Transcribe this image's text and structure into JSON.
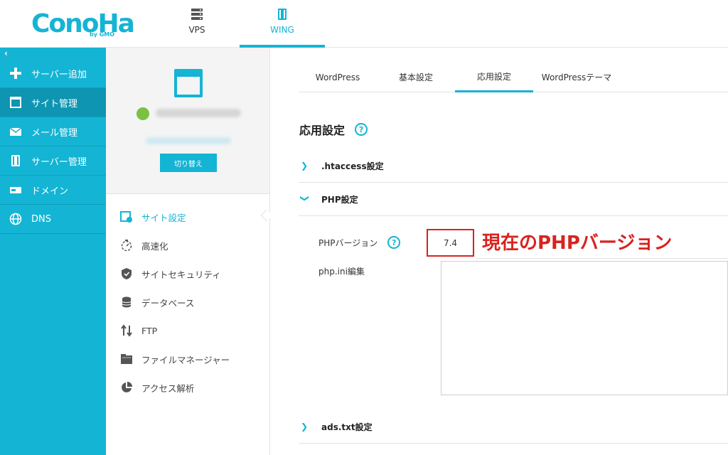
{
  "brand": {
    "logo": "ConoHa",
    "logo_sub": "by GMO"
  },
  "topnav": [
    {
      "label": "VPS",
      "icon": "server-icon"
    },
    {
      "label": "WING",
      "icon": "server-stack-icon",
      "active": true
    }
  ],
  "sidebar": {
    "collapse": "‹",
    "items": [
      {
        "label": "サーバー追加",
        "icon": "plus-icon"
      },
      {
        "label": "サイト管理",
        "icon": "window-icon",
        "active": true
      },
      {
        "label": "メール管理",
        "icon": "mail-icon"
      },
      {
        "label": "サーバー管理",
        "icon": "server-icon"
      },
      {
        "label": "ドメイン",
        "icon": "domain-icon"
      },
      {
        "label": "DNS",
        "icon": "globe-icon"
      }
    ]
  },
  "site_panel": {
    "switch_label": "切り替え",
    "menu": [
      {
        "label": "サイト設定",
        "icon": "site-settings-icon",
        "active": true
      },
      {
        "label": "高速化",
        "icon": "stopwatch-icon"
      },
      {
        "label": "サイトセキュリティ",
        "icon": "shield-icon"
      },
      {
        "label": "データベース",
        "icon": "database-icon"
      },
      {
        "label": "FTP",
        "icon": "transfer-arrows-icon"
      },
      {
        "label": "ファイルマネージャー",
        "icon": "folder-icon"
      },
      {
        "label": "アクセス解析",
        "icon": "pie-chart-icon"
      }
    ]
  },
  "main": {
    "tabs": [
      {
        "label": "WordPress"
      },
      {
        "label": "基本設定"
      },
      {
        "label": "応用設定",
        "active": true
      },
      {
        "label": "WordPressテーマ"
      }
    ],
    "section_title": "応用設定",
    "help_glyph": "?",
    "htaccess_label": ".htaccess設定",
    "php_label": "PHP設定",
    "php_version_label": "PHPバージョン",
    "php_version_value": "7.4",
    "php_version_note": "現在のPHPバージョン",
    "php_ini_label": "php.ini編集",
    "adstxt_label": "ads.txt設定"
  },
  "colors": {
    "accent": "#14b4d4",
    "highlight": "#d8231f",
    "power": "#7ac143"
  }
}
